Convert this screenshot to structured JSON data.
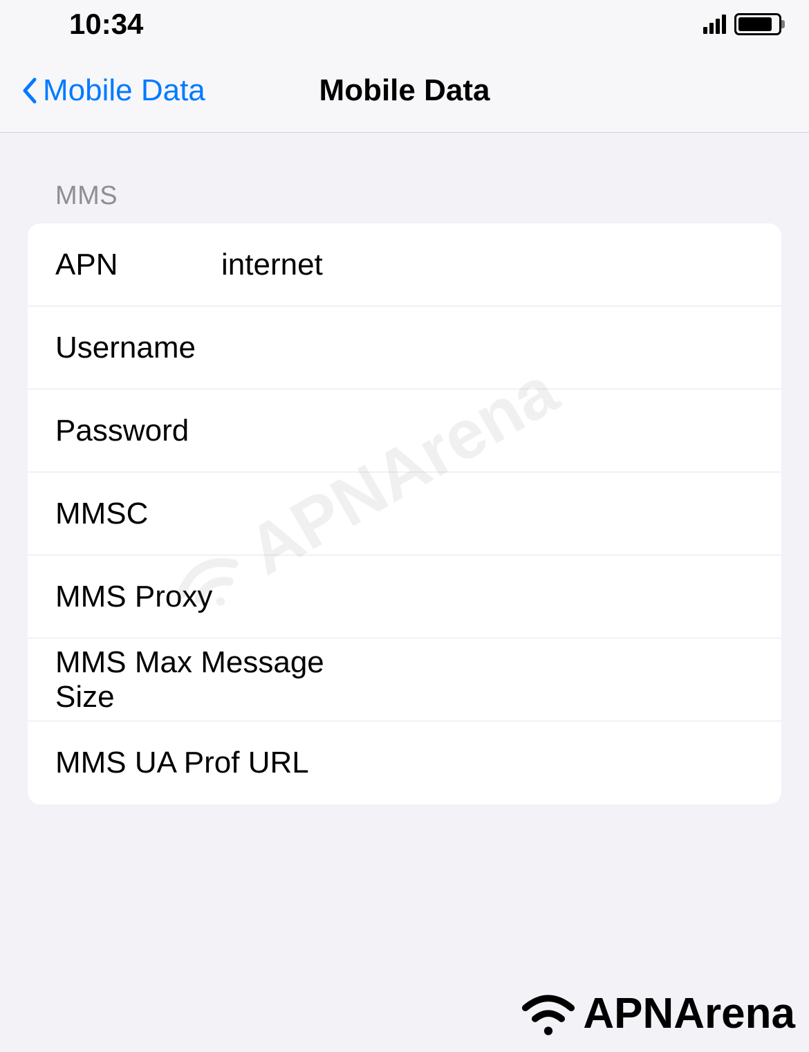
{
  "status_bar": {
    "time": "10:34"
  },
  "nav": {
    "back_label": "Mobile Data",
    "title": "Mobile Data"
  },
  "section": {
    "header": "MMS",
    "rows": [
      {
        "label": "APN",
        "value": "internet"
      },
      {
        "label": "Username",
        "value": ""
      },
      {
        "label": "Password",
        "value": ""
      },
      {
        "label": "MMSC",
        "value": ""
      },
      {
        "label": "MMS Proxy",
        "value": ""
      },
      {
        "label": "MMS Max Message Size",
        "value": ""
      },
      {
        "label": "MMS UA Prof URL",
        "value": ""
      }
    ]
  },
  "watermark": "APNArena",
  "footer_logo": "APNArena"
}
